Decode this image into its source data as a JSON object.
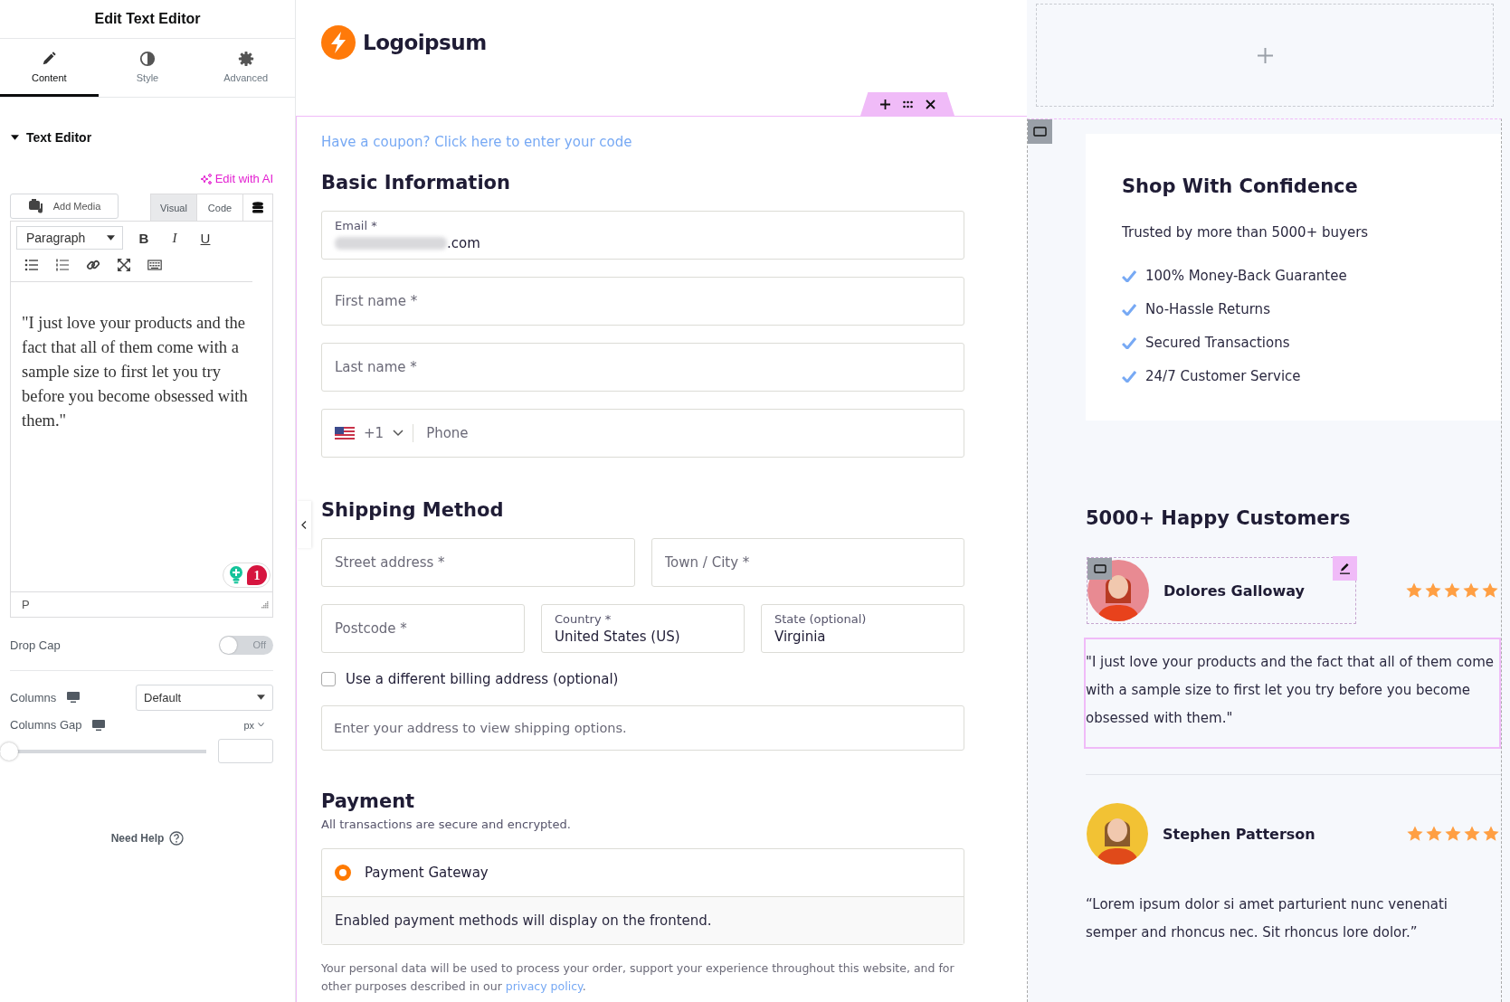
{
  "panel": {
    "title": "Edit Text Editor",
    "tabs": [
      {
        "label": "Content",
        "selected": true
      },
      {
        "label": "Style",
        "selected": false
      },
      {
        "label": "Advanced",
        "selected": false
      }
    ],
    "section": {
      "title": "Text Editor",
      "expanded": true
    },
    "ai_link": "Edit with AI",
    "add_media": "Add Media",
    "editor_tabs": [
      {
        "label": "Visual",
        "selected": true
      },
      {
        "label": "Code",
        "selected": false
      }
    ],
    "format_select": "Paragraph",
    "format_buttons": [
      "B",
      "I",
      "U"
    ],
    "editor_text": "\"I just love your products and the fact that all of them come with a sample size to first let you try before you become obsessed with them.\"",
    "grammar_count": "1",
    "path": "P",
    "controls": [
      {
        "kind": "toggle",
        "label": "Drop Cap",
        "on": false,
        "state_text": "Off"
      },
      {
        "kind": "select",
        "label": "Columns",
        "value": "Default"
      },
      {
        "kind": "slider",
        "label": "Columns Gap",
        "unit": "px",
        "level": 0
      }
    ],
    "help": "Need Help"
  },
  "canvas": {
    "logo": "Logoipsum",
    "coupon": "Have a coupon? Click here to enter your code",
    "basic": {
      "title": "Basic Information",
      "fields": [
        {
          "kind": "filled",
          "label": "Email *",
          "value": ".com",
          "redacted": true
        },
        {
          "kind": "empty",
          "placeholder": "First name *"
        },
        {
          "kind": "empty",
          "placeholder": "Last name *"
        },
        {
          "kind": "phone",
          "code": "+1",
          "placeholder": "Phone"
        }
      ]
    },
    "shipping": {
      "title": "Shipping Method",
      "rows": [
        [
          {
            "kind": "empty",
            "placeholder": "Street address *"
          },
          {
            "kind": "empty",
            "placeholder": "Town / City *"
          }
        ],
        [
          {
            "kind": "empty",
            "placeholder": "Postcode *"
          },
          {
            "kind": "filled",
            "label": "Country *",
            "value": "United States (US)"
          },
          {
            "kind": "filled",
            "label": "State (optional)",
            "value": "Virginia"
          }
        ]
      ],
      "billing": {
        "label": "Use a different billing address (optional)",
        "checked": false
      },
      "notice": "Enter your address to view shipping options."
    },
    "payment": {
      "title": "Payment",
      "subtitle": "All transactions are secure and encrypted.",
      "methods": [
        {
          "label": "Payment Gateway",
          "selected": true
        }
      ],
      "note": "Enabled payment methods will display on the frontend."
    },
    "privacy": {
      "text": "Your personal data will be used to process your order, support your experience throughout this website, and for other purposes described in our ",
      "link": "privacy policy",
      "after": "."
    }
  },
  "sidebar": {
    "confidence": {
      "title": "Shop With Confidence",
      "subtitle": "Trusted by more than 5000+ buyers",
      "items": [
        "100% Money-Back Guarantee",
        "No-Hassle Returns",
        "Secured Transactions",
        "24/7 Customer Service"
      ]
    },
    "reviews_title": "5000+ Happy Customers",
    "reviews": [
      {
        "name": "Dolores Galloway",
        "stars": 5,
        "selected": true,
        "quote": "\"I just love your products and the fact that all of them come with a sample size to first let you try before you become obsessed with them.\""
      },
      {
        "name": "Stephen Patterson",
        "stars": 5,
        "selected": false,
        "quote": "“Lorem ipsum dolor si amet parturient nunc venenati semper and rhoncus nec. Sit rhoncus lore dolor.”"
      }
    ]
  }
}
